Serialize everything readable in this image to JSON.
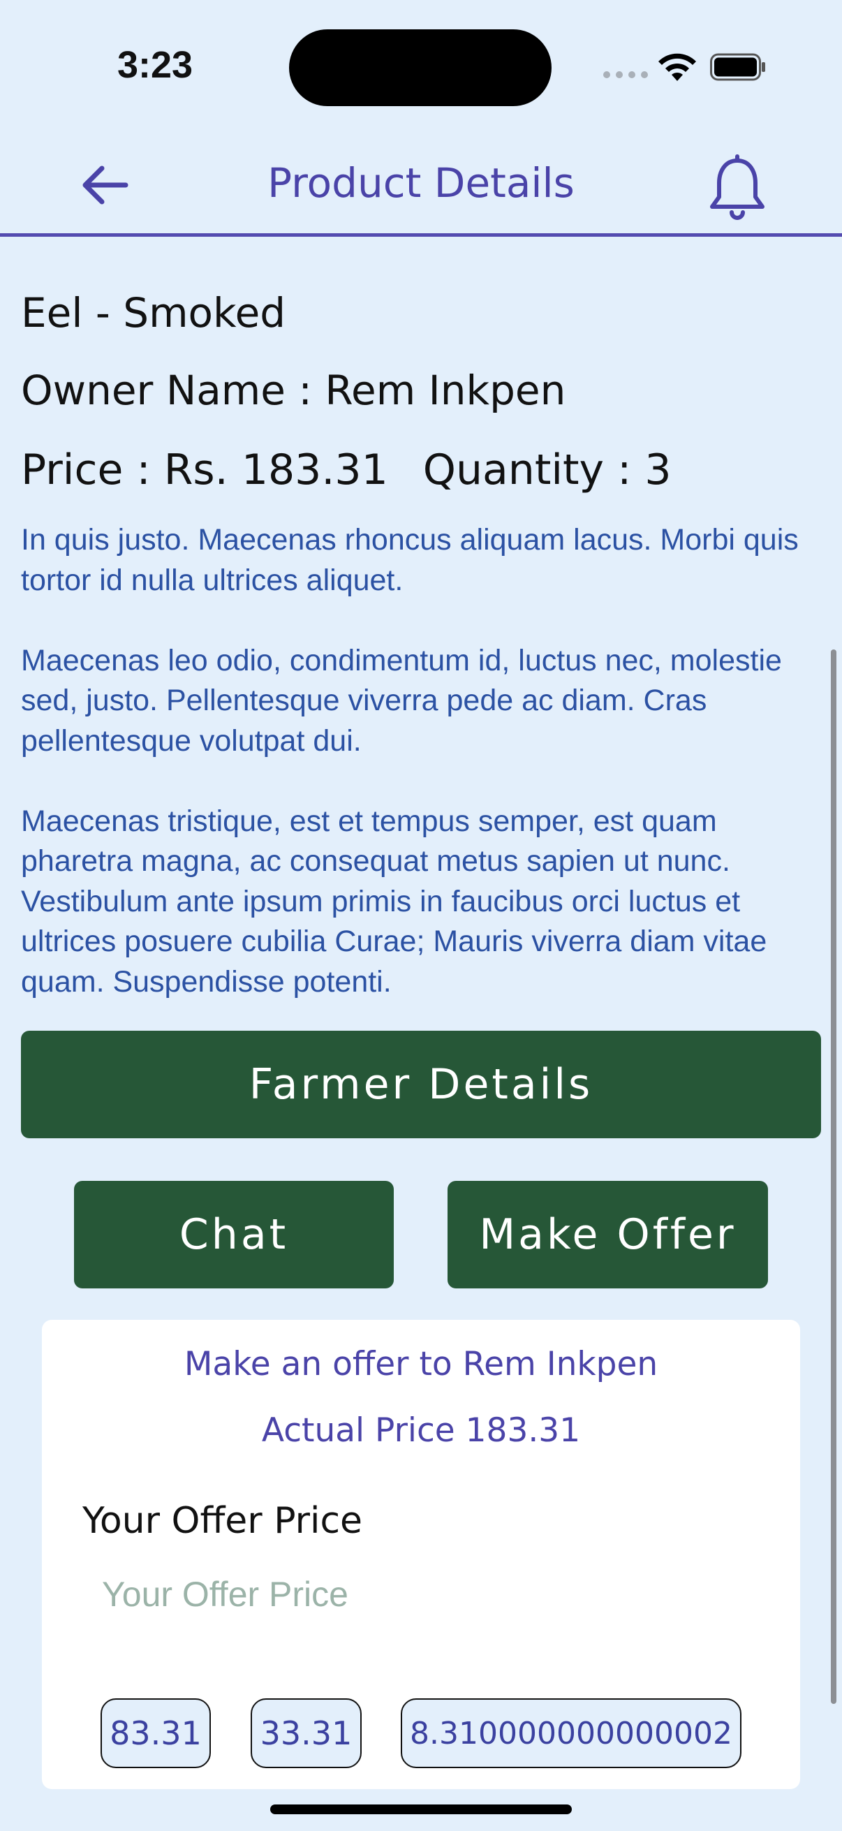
{
  "status_bar": {
    "time": "3:23"
  },
  "nav": {
    "title": "Product Details"
  },
  "product": {
    "name": "Eel - Smoked",
    "owner_line": "Owner Name : Rem Inkpen",
    "price_line": "Price : Rs. 183.31",
    "quantity_line": "Quantity : 3",
    "description": "In quis justo. Maecenas rhoncus aliquam lacus. Morbi quis tortor id nulla ultrices aliquet.\n\nMaecenas leo odio, condimentum id, luctus nec, molestie sed, justo. Pellentesque viverra pede ac diam. Cras pellentesque volutpat dui.\n\nMaecenas tristique, est et tempus semper, est quam pharetra magna, ac consequat metus sapien ut nunc. Vestibulum ante ipsum primis in faucibus orci luctus et ultrices posuere cubilia Curae; Mauris viverra diam vitae quam. Suspendisse potenti."
  },
  "actions": {
    "farmer_details": "Farmer Details",
    "chat": "Chat",
    "make_offer": "Make Offer"
  },
  "offer_card": {
    "heading": "Make an offer to Rem Inkpen",
    "actual_price": "Actual Price 183.31",
    "label": "Your Offer Price",
    "input_placeholder": "Your Offer Price",
    "input_value": "",
    "suggestions": [
      "83.31",
      "33.31",
      "8.310000000000002"
    ]
  },
  "colors": {
    "background": "#e3effb",
    "accent": "#4a43a8",
    "button_green": "#265737",
    "description_text": "#2b51a3"
  },
  "icons": {
    "back": "arrow-left-icon",
    "notifications": "bell-icon",
    "wifi": "wifi-icon",
    "battery": "battery-icon"
  }
}
